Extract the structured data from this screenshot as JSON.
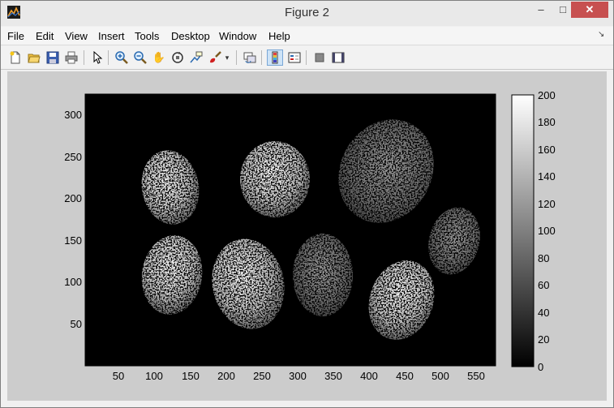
{
  "window": {
    "title": "Figure 2",
    "minimize_label": "–",
    "maximize_label": "□",
    "close_label": "✕"
  },
  "menu": {
    "items": [
      {
        "label": "File"
      },
      {
        "label": "Edit"
      },
      {
        "label": "View"
      },
      {
        "label": "Insert"
      },
      {
        "label": "Tools"
      },
      {
        "label": "Desktop"
      },
      {
        "label": "Window"
      },
      {
        "label": "Help"
      }
    ],
    "overflow_icon": "dock-arrow-icon"
  },
  "toolbar": {
    "buttons": [
      {
        "name": "new-figure-icon"
      },
      {
        "name": "open-file-icon"
      },
      {
        "name": "save-icon"
      },
      {
        "name": "print-icon"
      },
      {
        "name": "edit-plot-arrow-icon"
      },
      {
        "name": "zoom-in-icon"
      },
      {
        "name": "zoom-out-icon"
      },
      {
        "name": "pan-hand-icon"
      },
      {
        "name": "rotate-3d-icon"
      },
      {
        "name": "data-cursor-icon"
      },
      {
        "name": "brush-icon"
      },
      {
        "name": "link-plot-icon"
      },
      {
        "name": "colorbar-toggle-icon",
        "active": true
      },
      {
        "name": "legend-toggle-icon"
      },
      {
        "name": "hide-plot-tools-icon"
      },
      {
        "name": "show-plot-tools-icon"
      }
    ]
  },
  "axes": {
    "x_ticks": [
      "50",
      "100",
      "150",
      "200",
      "250",
      "300",
      "350",
      "400",
      "450",
      "500",
      "550"
    ],
    "y_ticks": [
      "300",
      "250",
      "200",
      "150",
      "100",
      "50"
    ],
    "xlim": [
      0,
      575
    ],
    "ylim": [
      0,
      325
    ]
  },
  "colorbar": {
    "ticks": [
      "200",
      "180",
      "160",
      "140",
      "120",
      "100",
      "80",
      "60",
      "40",
      "20",
      "0"
    ],
    "range": [
      0,
      200
    ],
    "colormap": "gray"
  },
  "colors": {
    "figure_bg": "#cccccc",
    "axes_bg": "#000000",
    "close_red": "#c75050",
    "active_tool": "#cde3f7"
  }
}
